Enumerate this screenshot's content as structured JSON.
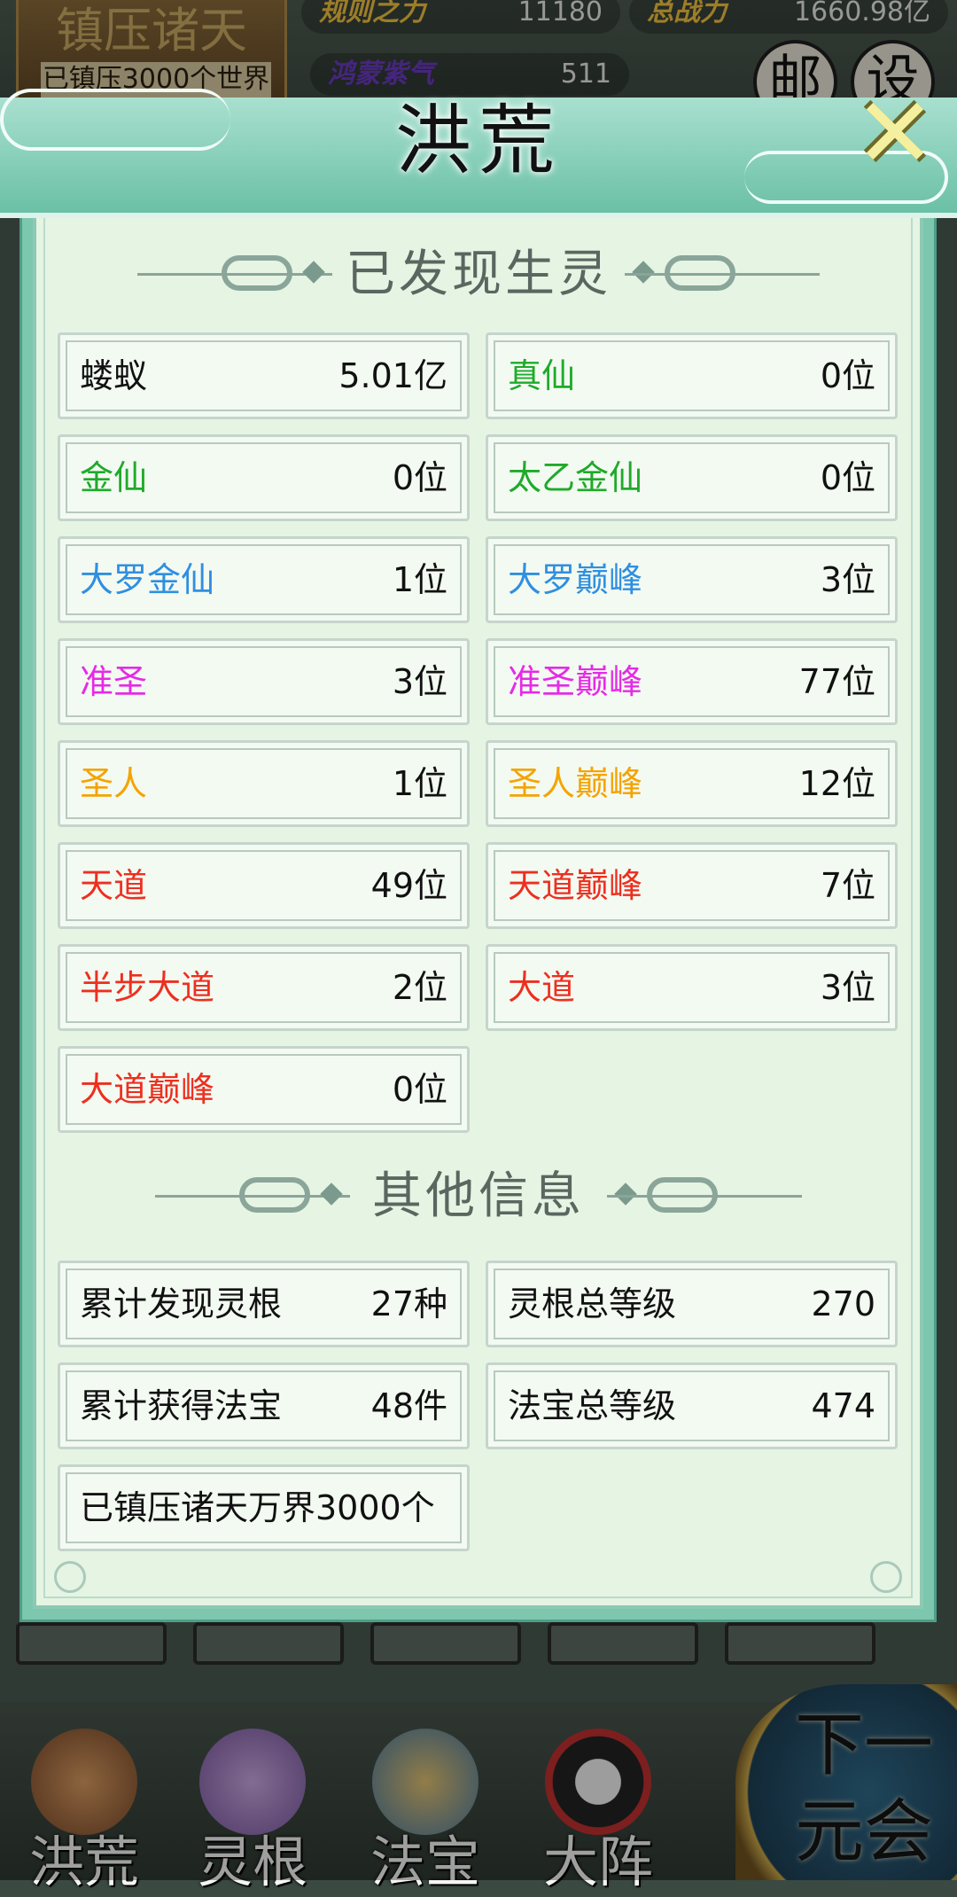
{
  "background": {
    "world_title": "镇压诸天",
    "world_subtitle": "已镇压3000个世界",
    "stats": [
      {
        "label": "规则之力",
        "value": "11180"
      },
      {
        "label": "总战力",
        "value": "1660.98亿"
      },
      {
        "label": "鸿蒙紫气",
        "value": "511"
      }
    ],
    "mail_label": "邮",
    "settings_label": "设",
    "bottom_nav": [
      {
        "label": "洪荒"
      },
      {
        "label": "灵根"
      },
      {
        "label": "法宝"
      },
      {
        "label": "大阵"
      }
    ],
    "next_button_label": "下一元会"
  },
  "dialog": {
    "title": "洪荒",
    "close_symbol": "✕",
    "sections": [
      {
        "title": "已发现生灵",
        "items": [
          {
            "label": "蝼蚁",
            "value": "5.01亿",
            "color": "#111111"
          },
          {
            "label": "真仙",
            "value": "0位",
            "color": "#1faa2a"
          },
          {
            "label": "金仙",
            "value": "0位",
            "color": "#1faa2a"
          },
          {
            "label": "太乙金仙",
            "value": "0位",
            "color": "#1faa2a"
          },
          {
            "label": "大罗金仙",
            "value": "1位",
            "color": "#2f8fe0"
          },
          {
            "label": "大罗巅峰",
            "value": "3位",
            "color": "#2f8fe0"
          },
          {
            "label": "准圣",
            "value": "3位",
            "color": "#e62ae6"
          },
          {
            "label": "准圣巅峰",
            "value": "77位",
            "color": "#e62ae6"
          },
          {
            "label": "圣人",
            "value": "1位",
            "color": "#f5a300"
          },
          {
            "label": "圣人巅峰",
            "value": "12位",
            "color": "#f5a300"
          },
          {
            "label": "天道",
            "value": "49位",
            "color": "#ee2f1f"
          },
          {
            "label": "天道巅峰",
            "value": "7位",
            "color": "#ee2f1f"
          },
          {
            "label": "半步大道",
            "value": "2位",
            "color": "#ee2f1f"
          },
          {
            "label": "大道",
            "value": "3位",
            "color": "#ee2f1f"
          },
          {
            "label": "大道巅峰",
            "value": "0位",
            "color": "#ee2f1f"
          }
        ]
      },
      {
        "title": "其他信息",
        "items": [
          {
            "label": "累计发现灵根",
            "value": "27种",
            "color": "#111111"
          },
          {
            "label": "灵根总等级",
            "value": "270",
            "color": "#111111"
          },
          {
            "label": "累计获得法宝",
            "value": "48件",
            "color": "#111111"
          },
          {
            "label": "法宝总等级",
            "value": "474",
            "color": "#111111"
          },
          {
            "label": "已镇压诸天万界3000个",
            "value": "",
            "color": "#111111"
          }
        ]
      }
    ]
  }
}
